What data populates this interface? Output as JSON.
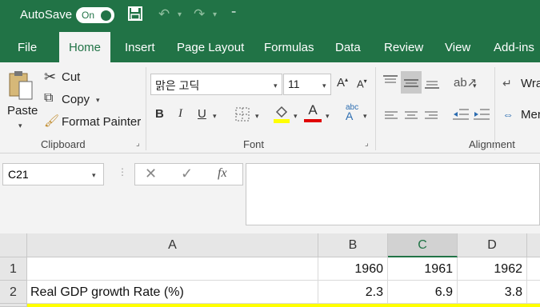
{
  "titlebar": {
    "autosave_label": "AutoSave",
    "autosave_state": "On",
    "more_label": "⁼"
  },
  "tabs": [
    {
      "label": "File"
    },
    {
      "label": "Home"
    },
    {
      "label": "Insert"
    },
    {
      "label": "Page Layout"
    },
    {
      "label": "Formulas"
    },
    {
      "label": "Data"
    },
    {
      "label": "Review"
    },
    {
      "label": "View"
    },
    {
      "label": "Add-ins"
    }
  ],
  "ribbon": {
    "clipboard": {
      "paste": "Paste",
      "cut": "Cut",
      "copy": "Copy",
      "format_painter": "Format Painter",
      "group_label": "Clipboard"
    },
    "font": {
      "font_name": "맑은 고딕",
      "font_size": "11",
      "bold": "B",
      "italic": "I",
      "underline": "U",
      "font_color_letter": "A",
      "group_label": "Font"
    },
    "alignment": {
      "wrap_text": "Wra",
      "merge": "Mer",
      "group_label": "Alignment"
    }
  },
  "formula_bar": {
    "name_box": "C21",
    "fx_label": "fx",
    "formula_value": ""
  },
  "sheet": {
    "columns": [
      "A",
      "B",
      "C",
      "D"
    ],
    "selected_column": "C",
    "rows": [
      {
        "num": "1",
        "cells": [
          "",
          "1960",
          "1961",
          "1962"
        ]
      },
      {
        "num": "2",
        "cells": [
          "Real GDP growth Rate (%)",
          "2.3",
          "6.9",
          "3.8"
        ]
      }
    ]
  },
  "colors": {
    "excel_green": "#217346",
    "highlight_yellow": "#ffff00",
    "font_red": "#e00000"
  }
}
